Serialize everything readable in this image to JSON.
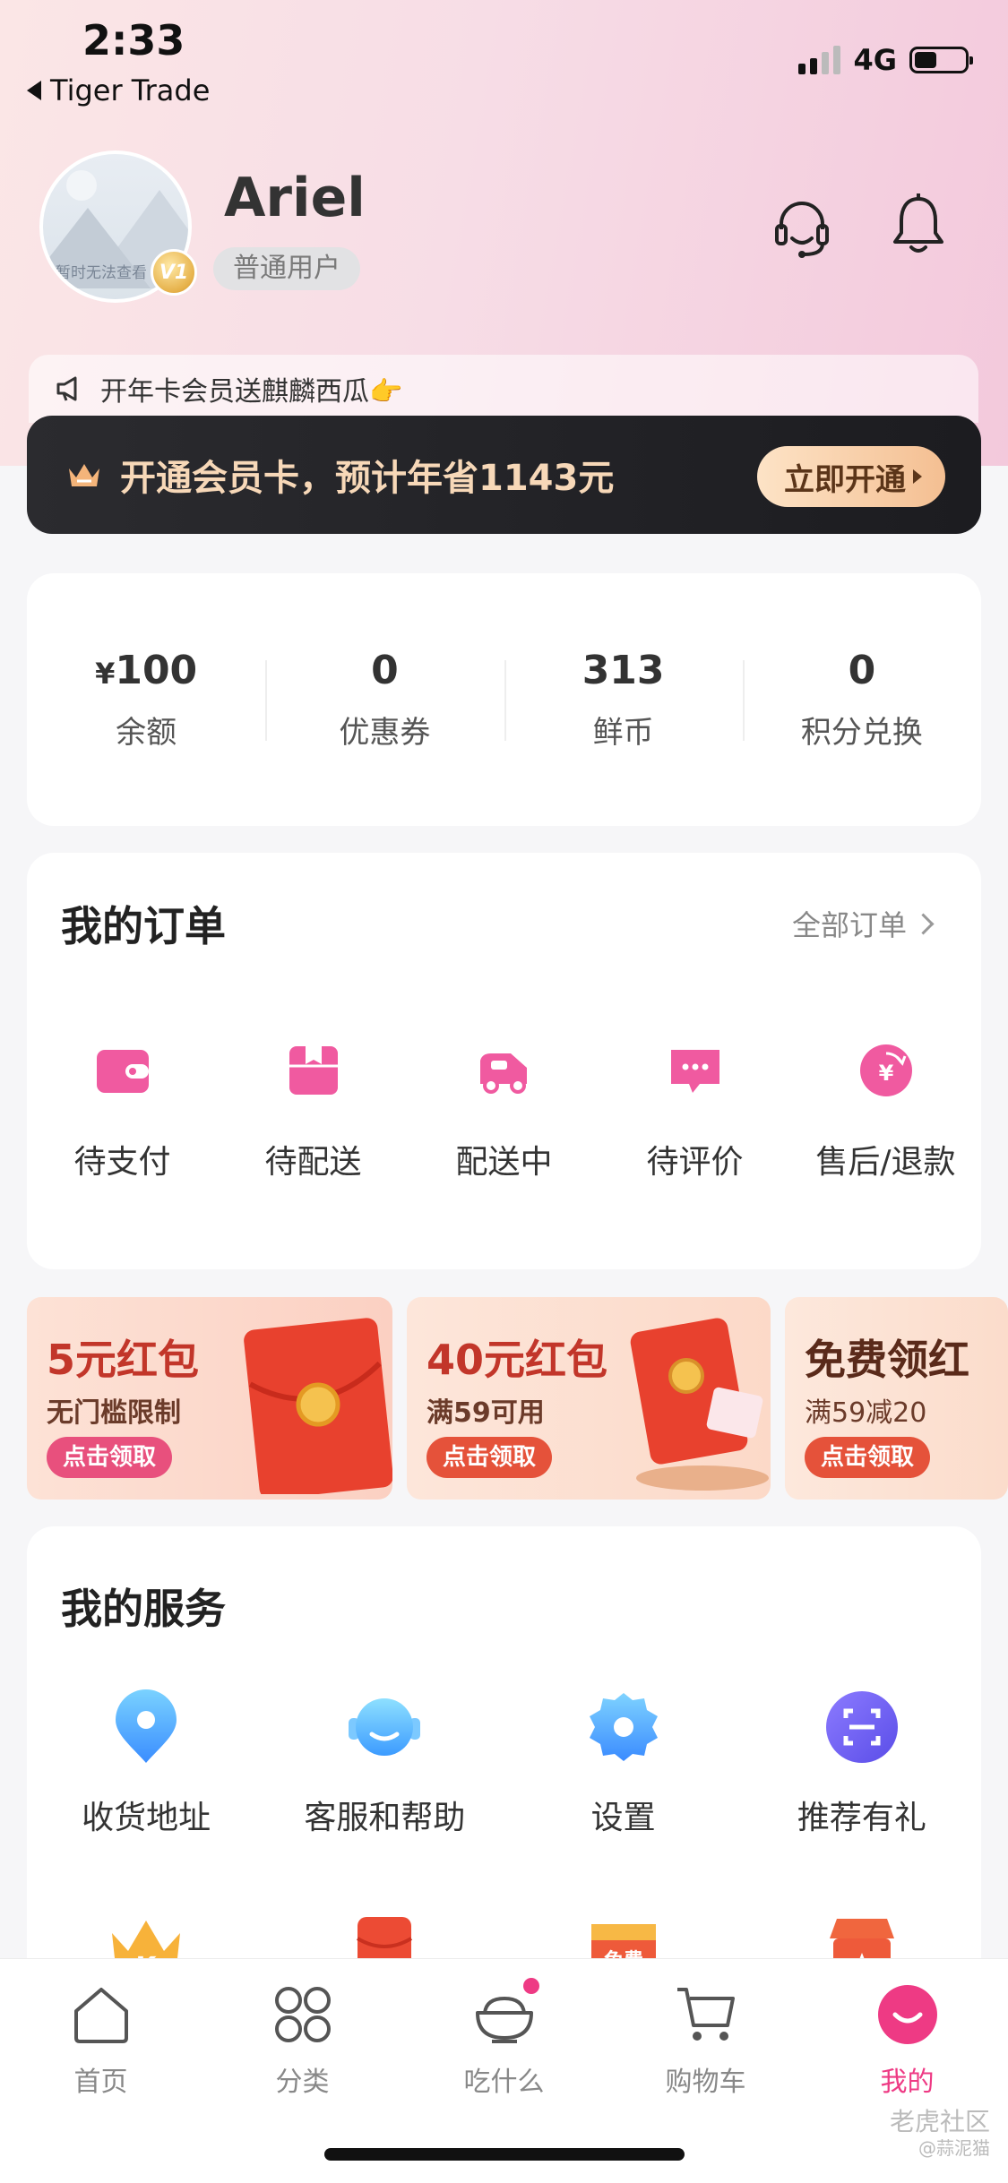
{
  "status_bar": {
    "time": "2:33",
    "back_app": "Tiger Trade",
    "network": "4G"
  },
  "profile": {
    "avatar_caption": "暂时无法查看",
    "level_badge": "V1",
    "username": "Ariel",
    "user_tag": "普通用户"
  },
  "notice": {
    "text": "开年卡会员送麒麟西瓜👉"
  },
  "vip": {
    "text": "开通会员卡，预计年省1143元",
    "button": "立即开通"
  },
  "stats": [
    {
      "prefix": "¥",
      "value": "100",
      "label": "余额"
    },
    {
      "prefix": "",
      "value": "0",
      "label": "优惠券"
    },
    {
      "prefix": "",
      "value": "313",
      "label": "鲜币"
    },
    {
      "prefix": "",
      "value": "0",
      "label": "积分兑换"
    }
  ],
  "orders": {
    "title": "我的订单",
    "all_link": "全部订单",
    "items": [
      {
        "icon": "wallet-icon",
        "label": "待支付"
      },
      {
        "icon": "package-icon",
        "label": "待配送"
      },
      {
        "icon": "delivery-truck-icon",
        "label": "配送中"
      },
      {
        "icon": "comment-icon",
        "label": "待评价"
      },
      {
        "icon": "refund-icon",
        "label": "售后/退款"
      }
    ]
  },
  "coupons": [
    {
      "title": "5元红包",
      "subtitle": "无门槛限制",
      "button": "点击领取"
    },
    {
      "title": "40元红包",
      "subtitle": "满59可用",
      "button": "点击领取"
    },
    {
      "title": "免费领红",
      "subtitle": "满59减20",
      "button": "点击领取"
    }
  ],
  "services": {
    "title": "我的服务",
    "items": [
      {
        "icon": "location-pin-icon",
        "label": "收货地址"
      },
      {
        "icon": "customer-service-icon",
        "label": "客服和帮助"
      },
      {
        "icon": "settings-gear-icon",
        "label": "设置"
      },
      {
        "icon": "scan-icon",
        "label": "推荐有礼"
      }
    ],
    "more_icons": [
      "crown-k-icon",
      "red-envelope-icon",
      "free-icon",
      "store-icon"
    ],
    "more_icon_text": {
      "crown": "K",
      "free": "免费"
    }
  },
  "tabbar": [
    {
      "icon": "home-icon",
      "label": "首页"
    },
    {
      "icon": "category-grid-icon",
      "label": "分类"
    },
    {
      "icon": "bowl-icon",
      "label": "吃什么"
    },
    {
      "icon": "cart-icon",
      "label": "购物车"
    },
    {
      "icon": "profile-smile-icon",
      "label": "我的"
    }
  ],
  "watermark": {
    "main": "老虎社区",
    "sub": "@蒜泥猫"
  },
  "colors": {
    "accent": "#ee3a84",
    "vip_gold": "#f7d8b8",
    "dark_bar": "#232327"
  }
}
